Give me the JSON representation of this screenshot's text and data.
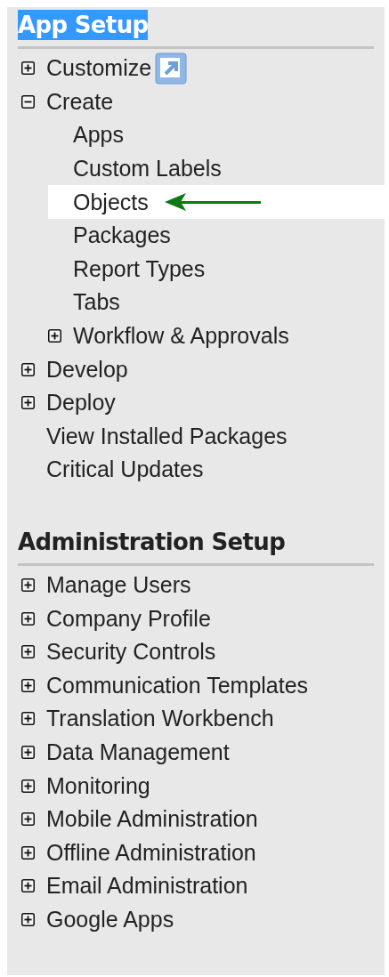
{
  "sections": [
    {
      "title": "App Setup",
      "selected": true,
      "items": [
        {
          "label": "Customize",
          "kind": "folder",
          "expanded": false,
          "popout": true,
          "selected": false
        },
        {
          "label": "Create",
          "kind": "folder",
          "expanded": true,
          "selected": false,
          "children": [
            {
              "label": "Apps",
              "kind": "link",
              "selected": false
            },
            {
              "label": "Custom Labels",
              "kind": "link",
              "selected": false
            },
            {
              "label": "Objects",
              "kind": "link",
              "selected": true
            },
            {
              "label": "Packages",
              "kind": "link",
              "selected": false
            },
            {
              "label": "Report Types",
              "kind": "link",
              "selected": false
            },
            {
              "label": "Tabs",
              "kind": "link",
              "selected": false
            },
            {
              "label": "Workflow & Approvals",
              "kind": "folder",
              "expanded": false,
              "selected": false
            }
          ]
        },
        {
          "label": "Develop",
          "kind": "folder",
          "expanded": false,
          "selected": false
        },
        {
          "label": "Deploy",
          "kind": "folder",
          "expanded": false,
          "selected": false
        },
        {
          "label": "View Installed Packages",
          "kind": "link",
          "selected": false
        },
        {
          "label": "Critical Updates",
          "kind": "link",
          "selected": false
        }
      ]
    },
    {
      "title": "Administration Setup",
      "selected": false,
      "items": [
        {
          "label": "Manage Users",
          "kind": "folder",
          "expanded": false,
          "selected": false
        },
        {
          "label": "Company Profile",
          "kind": "folder",
          "expanded": false,
          "selected": false
        },
        {
          "label": "Security Controls",
          "kind": "folder",
          "expanded": false,
          "selected": false
        },
        {
          "label": "Communication Templates",
          "kind": "folder",
          "expanded": false,
          "selected": false
        },
        {
          "label": "Translation Workbench",
          "kind": "folder",
          "expanded": false,
          "selected": false
        },
        {
          "label": "Data Management",
          "kind": "folder",
          "expanded": false,
          "selected": false
        },
        {
          "label": "Monitoring",
          "kind": "folder",
          "expanded": false,
          "selected": false
        },
        {
          "label": "Mobile Administration",
          "kind": "folder",
          "expanded": false,
          "selected": false
        },
        {
          "label": "Offline Administration",
          "kind": "folder",
          "expanded": false,
          "selected": false
        },
        {
          "label": "Email Administration",
          "kind": "folder",
          "expanded": false,
          "selected": false
        },
        {
          "label": "Google Apps",
          "kind": "folder",
          "expanded": false,
          "selected": false
        }
      ]
    }
  ]
}
